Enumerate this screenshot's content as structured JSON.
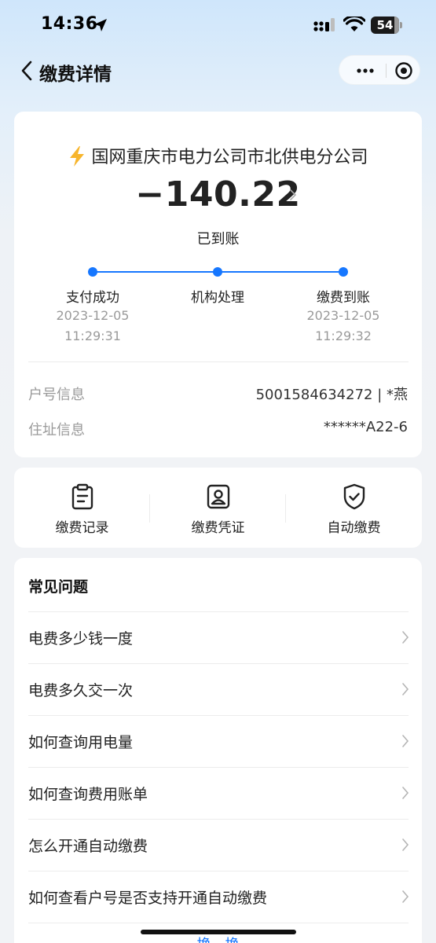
{
  "status_bar": {
    "time": "14:36",
    "battery": "54",
    "icons": [
      "location-arrow-icon",
      "cellular-signal-icon",
      "wifi-icon",
      "battery-icon"
    ]
  },
  "nav": {
    "title": "缴费详情",
    "icons": [
      "back-chevron-icon",
      "more-dots-icon",
      "target-circle-icon"
    ]
  },
  "payment": {
    "company": "国网重庆市电力公司市北供电分公司",
    "amount": "−140.22",
    "status": "已到账",
    "accent_color": "#1677ff",
    "steps": [
      {
        "label": "支付成功",
        "date": "2023-12-05",
        "time": "11:29:31"
      },
      {
        "label": "机构处理",
        "date": "",
        "time": ""
      },
      {
        "label": "缴费到账",
        "date": "2023-12-05",
        "time": "11:29:32"
      }
    ],
    "info": [
      {
        "label": "户号信息",
        "value": "5001584634272 | *燕"
      },
      {
        "label": "住址信息",
        "value": "******A22-6"
      }
    ]
  },
  "actions": [
    {
      "label": "缴费记录",
      "icon": "clipboard-icon"
    },
    {
      "label": "缴费凭证",
      "icon": "user-badge-icon"
    },
    {
      "label": "自动缴费",
      "icon": "shield-check-icon"
    }
  ],
  "faq": {
    "title": "常见问题",
    "items": [
      "电费多少钱一度",
      "电费多久交一次",
      "如何查询用电量",
      "如何查询费用账单",
      "怎么开通自动缴费",
      "如何查看户号是否支持开通自动缴费"
    ],
    "more_link": "换一换"
  }
}
